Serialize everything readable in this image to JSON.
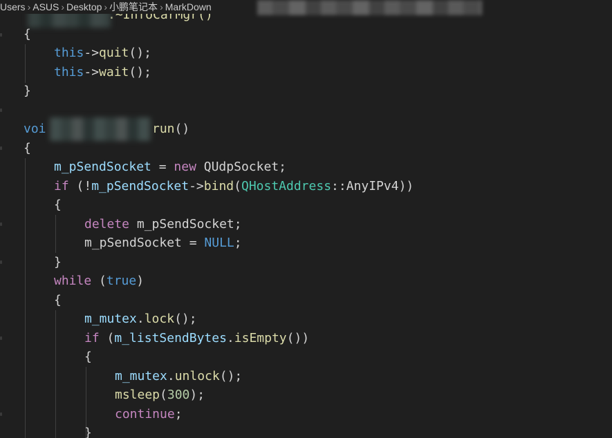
{
  "breadcrumb": {
    "items": [
      "Users",
      "ASUS",
      "Desktop",
      "小鹏笔记本",
      "MarkDown"
    ]
  },
  "code": {
    "line_partial": ".~InfoCarMgr()",
    "brace_open_0": "{",
    "l_this1": "this",
    "l_arrow1": "->",
    "l_quit": "quit",
    "l_quit_rest": "();",
    "l_this2": "this",
    "l_arrow2": "->",
    "l_wait": "wait",
    "l_wait_rest": "();",
    "brace_close_0": "}",
    "func_kw": "voi",
    "func_name": "run",
    "func_rest": "()",
    "brace_open_1": "{",
    "send_var": "m_pSendSocket",
    "assign": " = ",
    "new_kw": "new",
    "qudp": " QUdpSocket;",
    "if_kw": "if",
    "if_open": " (!",
    "if_var": "m_pSendSocket",
    "if_arrow": "->",
    "bind_fn": "bind",
    "paren_open": "(",
    "qhost": "QHostAddress",
    "qhost_rest": "::AnyIPv4))",
    "brace_open_2": "{",
    "delete_kw": "delete",
    "delete_rest": " m_pSendSocket;",
    "null_lhs": "m_pSendSocket = ",
    "null_kw": "NULL",
    "semi": ";",
    "brace_close_2": "}",
    "while_kw": "while",
    "while_open": " (",
    "true_kw": "true",
    "while_close": ")",
    "brace_open_3": "{",
    "mutex_var": "m_mutex",
    "mutex_dot": ".",
    "lock_fn": "lock",
    "lock_rest": "();",
    "if2_kw": "if",
    "if2_open": " (",
    "list_var": "m_listSendBytes",
    "list_dot": ".",
    "isempty_fn": "isEmpty",
    "isempty_rest": "())",
    "brace_open_4": "{",
    "mutex2_var": "m_mutex",
    "mutex2_dot": ".",
    "unlock_fn": "unlock",
    "unlock_rest": "();",
    "msleep_fn": "msleep",
    "msleep_open": "(",
    "msleep_num": "300",
    "msleep_close": ");",
    "continue_kw": "continue",
    "continue_semi": ";",
    "brace_close_4": "}"
  },
  "colors": {
    "background": "#1f1f1f",
    "keyword_blue": "#569cd6",
    "keyword_purple": "#c586c0",
    "function": "#dcdcaa",
    "variable": "#9cdcfe",
    "type": "#4ec9b0",
    "number": "#b5cea8",
    "text": "#d4d4d4"
  }
}
